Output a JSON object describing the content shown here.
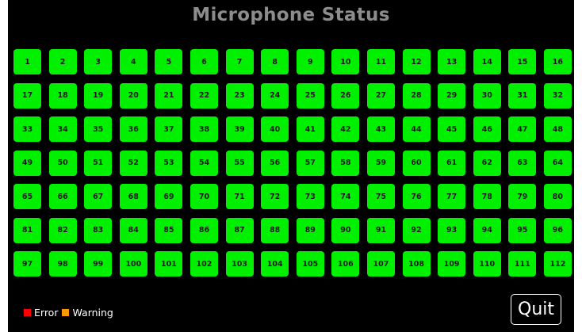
{
  "title": "Microphone Status",
  "tile_color": "#00f000",
  "microphones": [
    "1",
    "2",
    "3",
    "4",
    "5",
    "6",
    "7",
    "8",
    "9",
    "10",
    "11",
    "12",
    "13",
    "14",
    "15",
    "16",
    "17",
    "18",
    "19",
    "20",
    "21",
    "22",
    "23",
    "24",
    "25",
    "26",
    "27",
    "28",
    "29",
    "30",
    "31",
    "32",
    "33",
    "34",
    "35",
    "36",
    "37",
    "38",
    "39",
    "40",
    "41",
    "42",
    "43",
    "44",
    "45",
    "46",
    "47",
    "48",
    "49",
    "50",
    "51",
    "52",
    "53",
    "54",
    "55",
    "56",
    "57",
    "58",
    "59",
    "60",
    "61",
    "62",
    "63",
    "64",
    "65",
    "66",
    "67",
    "68",
    "69",
    "70",
    "71",
    "72",
    "73",
    "74",
    "75",
    "76",
    "77",
    "78",
    "79",
    "80",
    "81",
    "82",
    "83",
    "84",
    "85",
    "86",
    "87",
    "88",
    "89",
    "90",
    "91",
    "92",
    "93",
    "94",
    "95",
    "96",
    "97",
    "98",
    "99",
    "100",
    "101",
    "102",
    "103",
    "104",
    "105",
    "106",
    "107",
    "108",
    "109",
    "110",
    "111",
    "112"
  ],
  "legend": {
    "error": {
      "label": "Error",
      "color": "#ff0000"
    },
    "warning": {
      "label": "Warning",
      "color": "#ff9900"
    }
  },
  "quit_label": "Quit"
}
